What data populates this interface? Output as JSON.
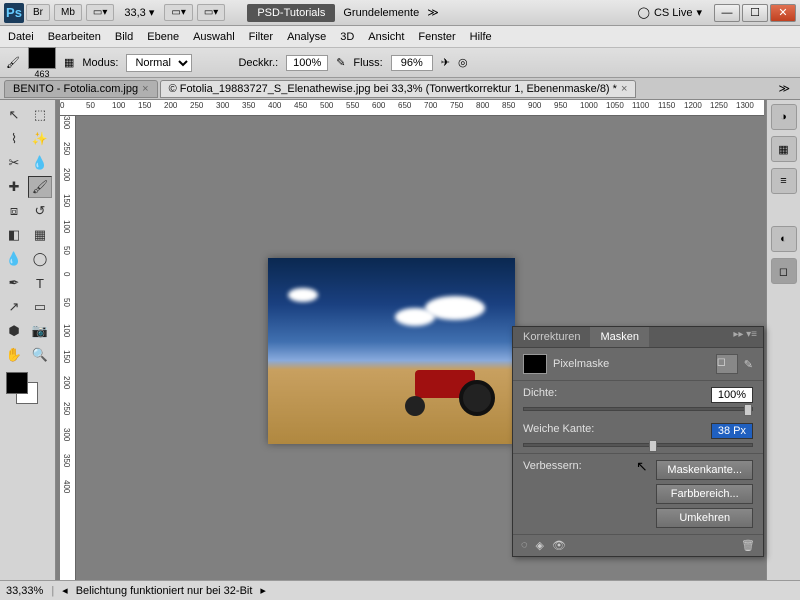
{
  "app": {
    "logo": "Ps",
    "zoom_display": "33,3",
    "workspace": "PSD-Tutorials",
    "subtitle": "Grundelemente",
    "cslive": "CS Live"
  },
  "titlebar_buttons": [
    "Br",
    "Mb"
  ],
  "menu": [
    "Datei",
    "Bearbeiten",
    "Bild",
    "Ebene",
    "Auswahl",
    "Filter",
    "Analyse",
    "3D",
    "Ansicht",
    "Fenster",
    "Hilfe"
  ],
  "options": {
    "swatch_number": "463",
    "mode_label": "Modus:",
    "mode_value": "Normal",
    "opacity_label": "Deckkr.:",
    "opacity_value": "100%",
    "flow_label": "Fluss:",
    "flow_value": "96%"
  },
  "tabs": [
    {
      "label": "BENITO - Fotolia.com.jpg",
      "active": false
    },
    {
      "label": "© Fotolia_19883727_S_Elenathewise.jpg bei 33,3% (Tonwertkorrektur 1, Ebenenmaske/8) *",
      "active": true
    }
  ],
  "ruler_h": [
    "0",
    "50",
    "100",
    "150",
    "200",
    "250",
    "300",
    "350",
    "400",
    "450",
    "500",
    "550",
    "600",
    "650",
    "700",
    "750",
    "800",
    "850",
    "900",
    "950",
    "1000",
    "1050",
    "1100",
    "1150",
    "1200",
    "1250",
    "1300"
  ],
  "ruler_v": [
    "300",
    "250",
    "200",
    "150",
    "100",
    "50",
    "0",
    "50",
    "100",
    "150",
    "200",
    "250",
    "300",
    "350",
    "400"
  ],
  "panel": {
    "tab1": "Korrekturen",
    "tab2": "Masken",
    "mask_type": "Pixelmaske",
    "density_label": "Dichte:",
    "density_value": "100%",
    "feather_label": "Weiche Kante:",
    "feather_value": "38 Px",
    "refine_label": "Verbessern:",
    "btn_edge": "Maskenkante...",
    "btn_colorrange": "Farbbereich...",
    "btn_invert": "Umkehren"
  },
  "status": {
    "zoom": "33,33%",
    "msg": "Belichtung funktioniert nur bei 32-Bit"
  }
}
